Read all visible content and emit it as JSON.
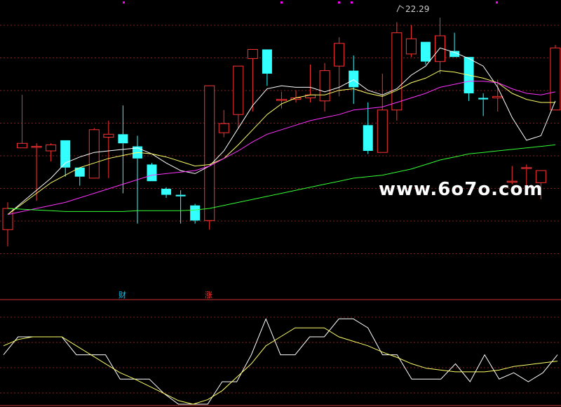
{
  "chart_data": {
    "type": "candlestick",
    "price_range": [
      5.6,
      23.3
    ],
    "candles": [
      {
        "o": 8.6,
        "h": 10.4,
        "l": 7.5,
        "c": 10.0
      },
      {
        "o": 14.0,
        "h": 17.5,
        "l": 14.0,
        "c": 14.3
      },
      {
        "o": 14.1,
        "h": 14.3,
        "l": 10.5,
        "c": 14.1
      },
      {
        "o": 13.8,
        "h": 14.3,
        "l": 13.1,
        "c": 14.2
      },
      {
        "o": 14.5,
        "h": 14.5,
        "l": 12.1,
        "c": 12.7
      },
      {
        "o": 12.7,
        "h": 12.7,
        "l": 11.5,
        "c": 12.1
      },
      {
        "o": 12.0,
        "h": 15.3,
        "l": 12.0,
        "c": 15.2
      },
      {
        "o": 14.7,
        "h": 15.8,
        "l": 12.0,
        "c": 14.9
      },
      {
        "o": 14.9,
        "h": 16.8,
        "l": 11.0,
        "c": 14.3
      },
      {
        "o": 14.1,
        "h": 14.8,
        "l": 9.0,
        "c": 13.3
      },
      {
        "o": 12.9,
        "h": 13.0,
        "l": 11.8,
        "c": 11.8
      },
      {
        "o": 11.3,
        "h": 11.4,
        "l": 10.7,
        "c": 10.9
      },
      {
        "o": 10.9,
        "h": 11.2,
        "l": 9.0,
        "c": 10.8
      },
      {
        "o": 10.2,
        "h": 10.3,
        "l": 9.0,
        "c": 9.2
      },
      {
        "o": 9.2,
        "h": 18.1,
        "l": 8.6,
        "c": 18.1
      },
      {
        "o": 15.0,
        "h": 16.5,
        "l": 14.7,
        "c": 15.6
      },
      {
        "o": 16.2,
        "h": 18.4,
        "l": 15.3,
        "c": 19.4
      },
      {
        "o": 19.9,
        "h": 20.4,
        "l": 16.4,
        "c": 20.5
      },
      {
        "o": 20.5,
        "h": 20.5,
        "l": 18.1,
        "c": 18.9
      },
      {
        "o": 17.2,
        "h": 17.7,
        "l": 16.6,
        "c": 17.2
      },
      {
        "o": 17.2,
        "h": 17.8,
        "l": 17.0,
        "c": 17.3
      },
      {
        "o": 17.3,
        "h": 19.5,
        "l": 17.0,
        "c": 17.5
      },
      {
        "o": 17.1,
        "h": 19.6,
        "l": 16.4,
        "c": 19.1
      },
      {
        "o": 19.4,
        "h": 21.3,
        "l": 17.4,
        "c": 20.9
      },
      {
        "o": 19.1,
        "h": 20.1,
        "l": 16.9,
        "c": 18.0
      },
      {
        "o": 15.5,
        "h": 17.0,
        "l": 13.6,
        "c": 13.8
      },
      {
        "o": 13.7,
        "h": 18.9,
        "l": 13.7,
        "c": 16.5
      },
      {
        "o": 16.5,
        "h": 22.3,
        "l": 15.8,
        "c": 21.6
      },
      {
        "o": 20.2,
        "h": 22.1,
        "l": 20.0,
        "c": 21.2
      },
      {
        "o": 21.0,
        "h": 21.0,
        "l": 19.5,
        "c": 19.7
      },
      {
        "o": 19.7,
        "h": 22.6,
        "l": 18.9,
        "c": 21.4
      },
      {
        "o": 20.4,
        "h": 21.6,
        "l": 20.0,
        "c": 20.0
      },
      {
        "o": 20.0,
        "h": 20.0,
        "l": 17.1,
        "c": 17.6
      },
      {
        "o": 17.3,
        "h": 17.6,
        "l": 16.1,
        "c": 17.2
      },
      {
        "o": 17.3,
        "h": 18.5,
        "l": 16.4,
        "c": 17.4
      },
      {
        "o": 11.8,
        "h": 12.8,
        "l": 11.6,
        "c": 11.8
      },
      {
        "o": 12.7,
        "h": 12.9,
        "l": 11.4,
        "c": 12.7
      },
      {
        "o": 11.7,
        "h": 12.5,
        "l": 10.6,
        "c": 12.5
      },
      {
        "o": 16.5,
        "h": 20.8,
        "l": 16.5,
        "c": 20.6
      }
    ],
    "ma_series": [
      {
        "color": "#ffffff",
        "values": [
          9.6,
          10.4,
          11.2,
          12.0,
          13.0,
          13.4,
          13.7,
          13.8,
          13.9,
          14.0,
          13.6,
          13.0,
          12.5,
          12.3,
          12.8,
          13.8,
          15.3,
          16.8,
          17.9,
          18.1,
          18.0,
          18.0,
          17.7,
          18.0,
          18.5,
          17.8,
          17.5,
          17.9,
          18.8,
          19.4,
          20.6,
          20.3,
          19.9,
          19.4,
          18.0,
          16.0,
          14.5,
          14.8,
          17.1
        ]
      },
      {
        "color": "#ffff66",
        "values": [
          9.6,
          10.3,
          11.0,
          11.7,
          12.2,
          12.7,
          13.0,
          13.3,
          13.5,
          13.7,
          13.6,
          13.4,
          13.1,
          12.8,
          12.9,
          13.3,
          14.2,
          15.2,
          16.2,
          16.9,
          17.3,
          17.5,
          17.5,
          17.8,
          17.9,
          17.6,
          17.4,
          17.8,
          18.3,
          18.6,
          19.1,
          19.0,
          18.8,
          18.6,
          18.3,
          17.6,
          17.2,
          17.0,
          17.0
        ]
      },
      {
        "color": "#ff33ff",
        "values": [
          9.6,
          9.8,
          10.0,
          10.2,
          10.4,
          10.7,
          11.0,
          11.3,
          11.6,
          11.9,
          12.2,
          12.3,
          12.4,
          12.5,
          12.8,
          13.3,
          13.8,
          14.4,
          14.9,
          15.2,
          15.5,
          15.8,
          16.0,
          16.2,
          16.5,
          16.6,
          16.7,
          17.0,
          17.3,
          17.6,
          18.0,
          18.2,
          18.4,
          18.4,
          18.3,
          17.9,
          17.6,
          17.5,
          17.7
        ]
      },
      {
        "color": "#33ff33",
        "values": [
          10.0,
          9.95,
          9.9,
          9.85,
          9.8,
          9.8,
          9.8,
          9.8,
          9.8,
          9.85,
          9.85,
          9.85,
          9.85,
          9.9,
          10.0,
          10.2,
          10.4,
          10.6,
          10.8,
          11.0,
          11.2,
          11.4,
          11.6,
          11.8,
          12.0,
          12.1,
          12.2,
          12.4,
          12.6,
          12.9,
          13.2,
          13.4,
          13.6,
          13.7,
          13.8,
          13.9,
          14.0,
          14.1,
          14.2
        ]
      }
    ],
    "peak_label": "22.29",
    "markers": [
      {
        "text": "财",
        "color": "#00ccff"
      },
      {
        "text": "涨",
        "color": "#ff3333"
      }
    ],
    "indicator": {
      "range": [
        0,
        100
      ],
      "lines": [
        {
          "color": "#ffffff",
          "values": [
            55,
            75,
            75,
            75,
            75,
            55,
            55,
            55,
            28,
            28,
            28,
            12,
            0,
            0,
            0,
            25,
            25,
            55,
            95,
            55,
            55,
            75,
            75,
            95,
            95,
            85,
            55,
            55,
            28,
            28,
            28,
            45,
            25,
            55,
            28,
            35,
            25,
            35,
            55
          ]
        },
        {
          "color": "#ffff66",
          "values": [
            65,
            72,
            75,
            75,
            75,
            65,
            55,
            45,
            35,
            28,
            20,
            12,
            4,
            0,
            5,
            15,
            30,
            45,
            65,
            75,
            85,
            85,
            85,
            75,
            70,
            65,
            58,
            52,
            45,
            40,
            38,
            36,
            36,
            36,
            38,
            42,
            44,
            46,
            48
          ]
        }
      ]
    }
  },
  "watermark": "www.6o7o.com",
  "colors": {
    "up": "#ff3333",
    "down": "#33ffff",
    "grid": "#882222",
    "top_dots": "#ff00ff",
    "divider": "#cc3333"
  }
}
